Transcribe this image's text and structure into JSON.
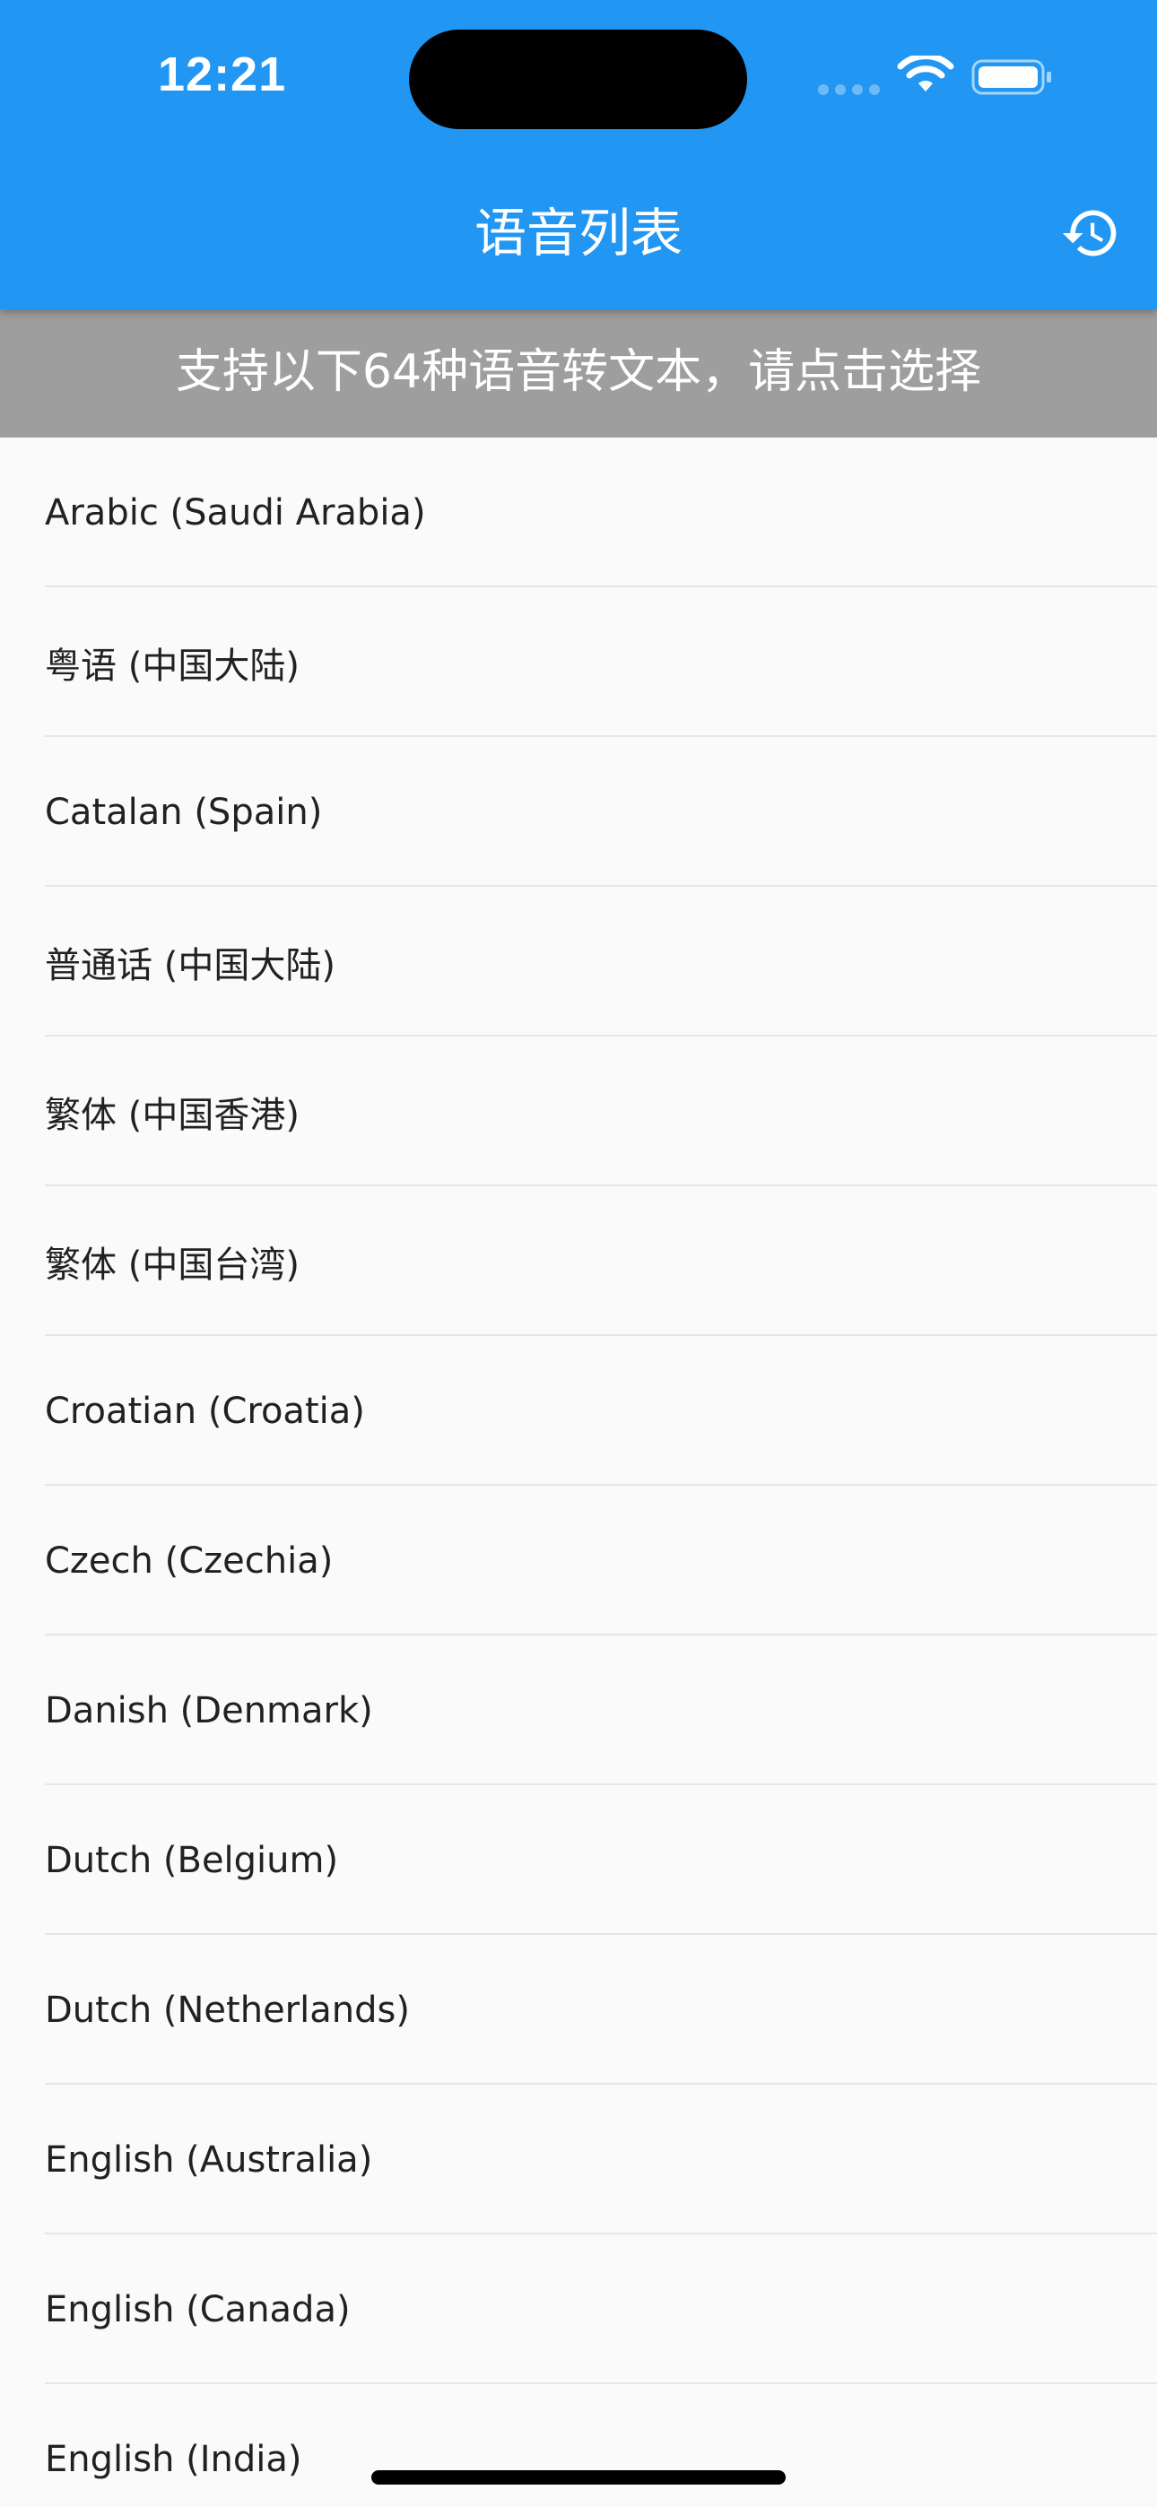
{
  "status_bar": {
    "time": "12:21",
    "icons": [
      "signal-icon",
      "wifi-icon",
      "battery-icon"
    ]
  },
  "app_bar": {
    "title": "语音列表",
    "action_icon": "history-icon",
    "background_color": "#2196f3"
  },
  "subheader": {
    "text": "支持以下64种语音转文本，请点击选择",
    "background_color": "#9e9e9e"
  },
  "languages": [
    "Arabic (Saudi Arabia)",
    "粤语 (中国大陆)",
    "Catalan (Spain)",
    "普通话 (中国大陆)",
    "繁体 (中国香港)",
    "繁体 (中国台湾)",
    "Croatian (Croatia)",
    "Czech (Czechia)",
    "Danish (Denmark)",
    "Dutch (Belgium)",
    "Dutch (Netherlands)",
    "English (Australia)",
    "English (Canada)",
    "English (India)"
  ]
}
